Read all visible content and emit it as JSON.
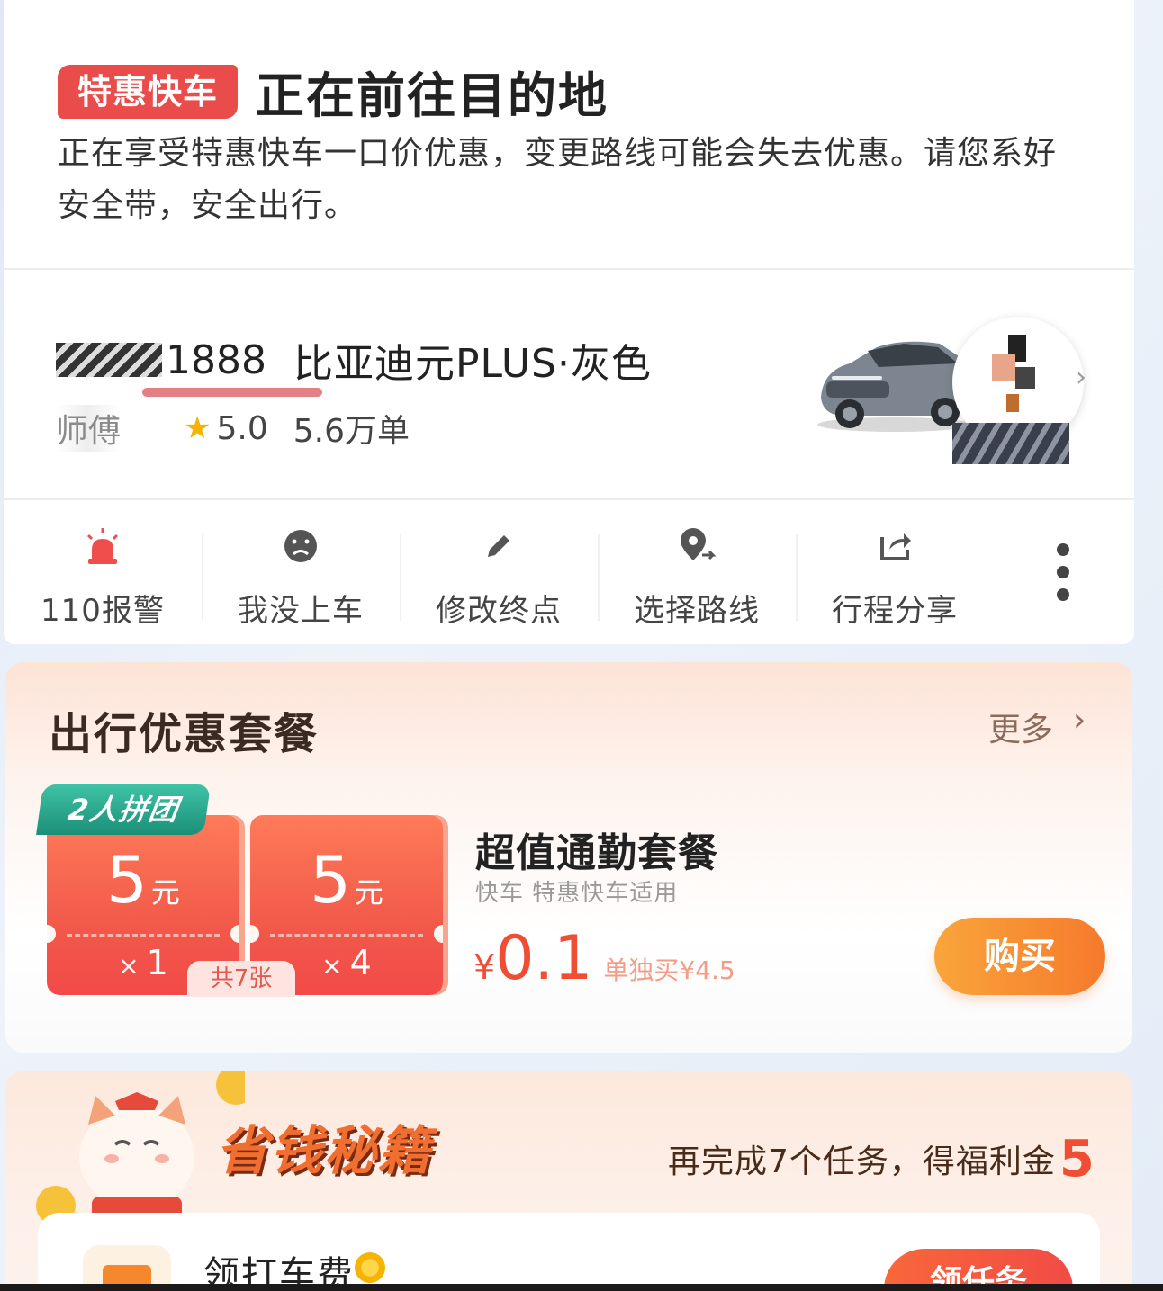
{
  "trip": {
    "tag": "特惠快车",
    "status": "正在前往目的地",
    "notice": "正在享受特惠快车一口价优惠，变更路线可能会失去优惠。请您系好安全带，安全出行。"
  },
  "driver": {
    "plate_visible": "1888",
    "car_model": "比亚迪元PLUS·灰色",
    "name": "师傅",
    "rating": "5.0",
    "orders": "5.6万单"
  },
  "actions": [
    {
      "label": "110报警",
      "icon": "alarm-icon"
    },
    {
      "label": "我没上车",
      "icon": "sad-face-icon"
    },
    {
      "label": "修改终点",
      "icon": "pencil-icon"
    },
    {
      "label": "选择路线",
      "icon": "route-icon"
    },
    {
      "label": "行程分享",
      "icon": "share-icon"
    }
  ],
  "package": {
    "title": "出行优惠套餐",
    "more": "更多",
    "group_badge": "2人拼团",
    "tickets": [
      {
        "amount": "5",
        "unit": "元",
        "times": "×",
        "count": "1"
      },
      {
        "amount": "5",
        "unit": "元",
        "times": "×",
        "count": "4"
      }
    ],
    "total": "共7张",
    "offer_title": "超值通勤套餐",
    "offer_sub": "快车 特惠快车适用",
    "currency": "¥",
    "price": "0.1",
    "original": "单独买¥4.5",
    "buy": "购买"
  },
  "save": {
    "title": "省钱秘籍",
    "tasks_text": "再完成7个任务，得福利金",
    "tasks_reward": "5",
    "task_title": "领打车费",
    "task_button": "领任务"
  },
  "colors": {
    "tag_red": "#ea4b4b",
    "accent_orange": "#f57a2c",
    "price_red": "#f04d35",
    "badge_green": "#1b8f78"
  }
}
